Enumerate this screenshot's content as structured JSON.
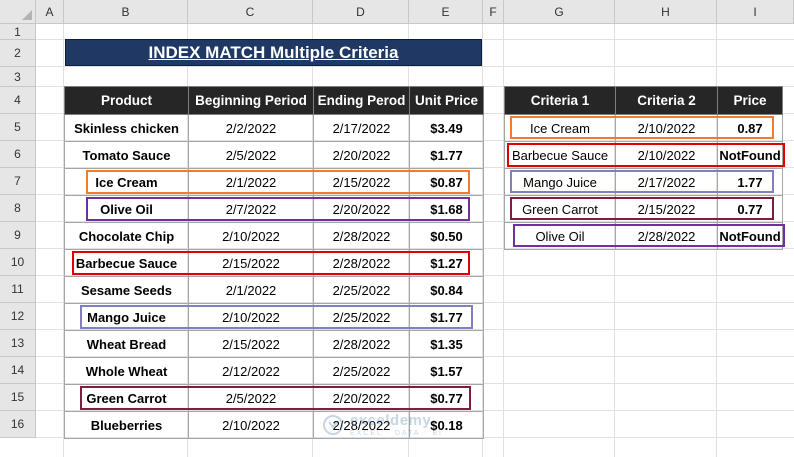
{
  "sheet": {
    "columns": [
      "A",
      "B",
      "C",
      "D",
      "E",
      "F",
      "G",
      "H",
      "I"
    ],
    "rows": [
      "1",
      "2",
      "3",
      "4",
      "5",
      "6",
      "7",
      "8",
      "9",
      "10",
      "11",
      "12",
      "13",
      "14",
      "15",
      "16"
    ]
  },
  "title": "INDEX MATCH Multiple Criteria",
  "main_table": {
    "headers": [
      "Product",
      "Beginning Period",
      "Ending Perod",
      "Unit Price"
    ],
    "rows": [
      [
        "Skinless chicken",
        "2/2/2022",
        "2/17/2022",
        "$3.49"
      ],
      [
        "Tomato Sauce",
        "2/5/2022",
        "2/20/2022",
        "$1.77"
      ],
      [
        "Ice Cream",
        "2/1/2022",
        "2/15/2022",
        "$0.87"
      ],
      [
        "Olive Oil",
        "2/7/2022",
        "2/20/2022",
        "$1.68"
      ],
      [
        "Chocolate Chip",
        "2/10/2022",
        "2/28/2022",
        "$0.50"
      ],
      [
        "Barbecue Sauce",
        "2/15/2022",
        "2/28/2022",
        "$1.27"
      ],
      [
        "Sesame Seeds",
        "2/1/2022",
        "2/25/2022",
        "$0.84"
      ],
      [
        "Mango Juice",
        "2/10/2022",
        "2/25/2022",
        "$1.77"
      ],
      [
        "Wheat Bread",
        "2/15/2022",
        "2/28/2022",
        "$1.35"
      ],
      [
        "Whole Wheat",
        "2/12/2022",
        "2/25/2022",
        "$1.57"
      ],
      [
        "Green Carrot",
        "2/5/2022",
        "2/20/2022",
        "$0.77"
      ],
      [
        "Blueberries",
        "2/10/2022",
        "2/28/2022",
        "$0.18"
      ]
    ]
  },
  "criteria_table": {
    "headers": [
      "Criteria 1",
      "Criteria 2",
      "Price"
    ],
    "rows": [
      [
        "Ice Cream",
        "2/10/2022",
        "0.87"
      ],
      [
        "Barbecue Sauce",
        "2/10/2022",
        "NotFound"
      ],
      [
        "Mango Juice",
        "2/17/2022",
        "1.77"
      ],
      [
        "Green Carrot",
        "2/15/2022",
        "0.77"
      ],
      [
        "Olive Oil",
        "2/28/2022",
        "NotFound"
      ]
    ]
  },
  "colors": {
    "header_bg": "#262626",
    "title_bg": "#1f3864",
    "highlight_ice_cream": "#ed7d31",
    "highlight_barbecue": "#e00000",
    "highlight_olive_oil": "#7030a0",
    "highlight_mango": "#8080c0",
    "highlight_green_carrot": "#7f1d3c"
  },
  "watermark": {
    "name": "exceldemy",
    "tagline": "EXCEL · DATA · BI",
    "icon": "exceldemy-logo-icon"
  }
}
